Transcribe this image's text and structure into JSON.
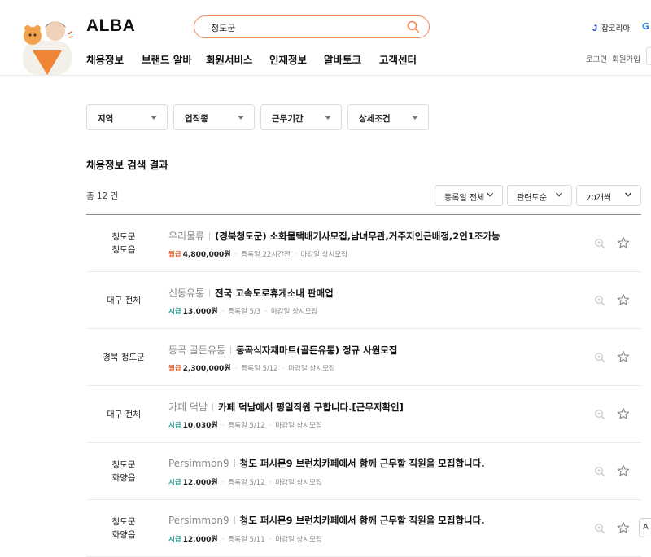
{
  "header": {
    "logo": "ALBA",
    "search_value": "청도군",
    "nav": [
      "채용정보",
      "브랜드 알바",
      "회원서비스",
      "인재정보",
      "알바토크",
      "고객센터"
    ],
    "jobkorea_mark": "J",
    "jobkorea_label": "잡코리아",
    "g_mark": "G",
    "login": "로그인",
    "signup": "회원가입"
  },
  "filters": [
    "지역",
    "업직종",
    "근무기간",
    "상세조건"
  ],
  "results": {
    "title": "채용정보 검색 결과",
    "total": "총 12 건",
    "sort": [
      "등록일 전체",
      "관련도순",
      "20개씩"
    ]
  },
  "colors": {
    "monthly": "#e8612c",
    "hourly": "#2aa39a",
    "search_border": "#f08a5d"
  },
  "listings": [
    {
      "loc1": "청도군",
      "loc2": "청도읍",
      "company": "우리물류",
      "title": "(경북청도군) 소화물택배기사모집,남녀무관,거주지인근배정,2인1조가능",
      "pay_type": "월급",
      "pay_color": "#e8612c",
      "pay": "4,800,000원",
      "registered": "등록일 22시간전",
      "deadline": "마감일 상시모집"
    },
    {
      "loc1": "대구 전체",
      "loc2": "",
      "company": "신동유통",
      "title": "전국 고속도로휴게소내 판매업",
      "pay_type": "시급",
      "pay_color": "#2aa39a",
      "pay": "13,000원",
      "registered": "등록일 5/3",
      "deadline": "마감일 상시모집"
    },
    {
      "loc1": "경북 청도군",
      "loc2": "",
      "company": "동곡 골든유통",
      "title": "동곡식자재마트(골든유통) 정규 사원모집",
      "pay_type": "월급",
      "pay_color": "#e8612c",
      "pay": "2,300,000원",
      "registered": "등록일 5/12",
      "deadline": "마감일 상시모집"
    },
    {
      "loc1": "대구 전체",
      "loc2": "",
      "company": "카페 덕남",
      "title": "카페 덕남에서 평일직원 구합니다.[근무지확인]",
      "pay_type": "시급",
      "pay_color": "#2aa39a",
      "pay": "10,030원",
      "registered": "등록일 5/12",
      "deadline": "마감일 상시모집"
    },
    {
      "loc1": "청도군",
      "loc2": "화양읍",
      "company": "Persimmon9",
      "title": "청도 퍼시몬9 브런치카페에서 함께 근무할 직원을 모집합니다.",
      "pay_type": "시급",
      "pay_color": "#2aa39a",
      "pay": "12,000원",
      "registered": "등록일 5/12",
      "deadline": "마감일 상시모집"
    },
    {
      "loc1": "청도군",
      "loc2": "화양읍",
      "company": "Persimmon9",
      "title": "청도 퍼시몬9 브런치카페에서 함께 근무할 직원을 모집합니다.",
      "pay_type": "시급",
      "pay_color": "#2aa39a",
      "pay": "12,000원",
      "registered": "등록일 5/11",
      "deadline": "마감일 상시모집"
    }
  ],
  "floating_tab": "A"
}
